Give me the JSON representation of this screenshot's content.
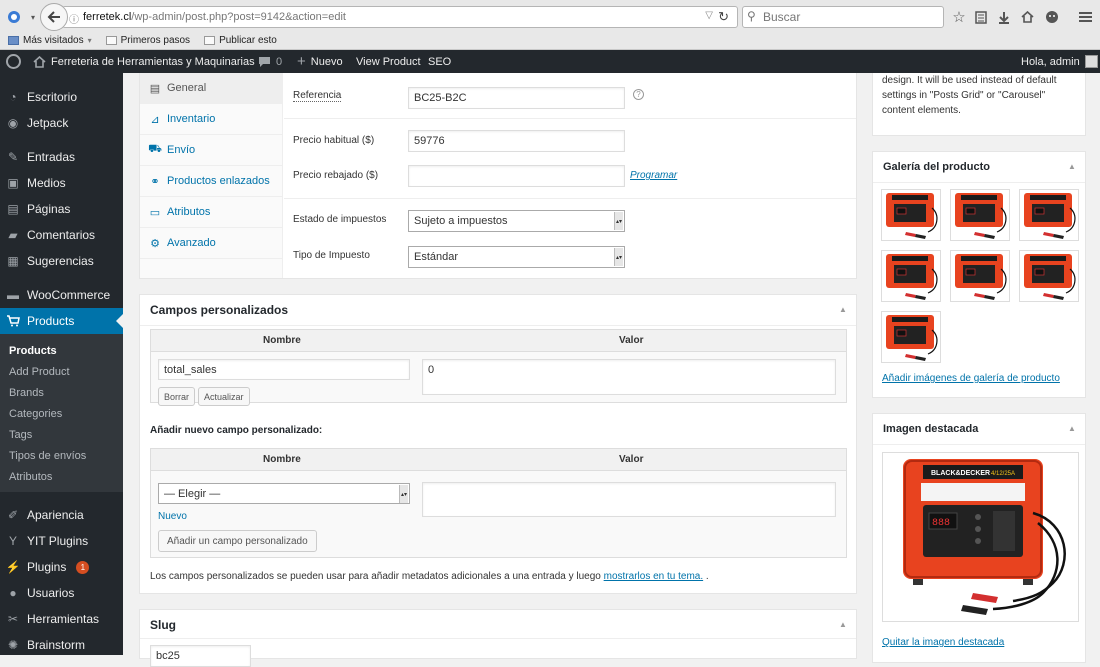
{
  "browser": {
    "url_host": "ferretek.cl",
    "url_path": "/wp-admin/post.php?post=9142&action=edit",
    "search_placeholder": "Buscar",
    "bookmarks": [
      "Más visitados",
      "Primeros pasos",
      "Publicar esto"
    ]
  },
  "admin_bar": {
    "site_name": "Ferreteria de Herramientas y Maquinarias",
    "comments_count": "0",
    "new_label": "Nuevo",
    "view_product": "View Product",
    "seo": "SEO",
    "greeting": "Hola, admin"
  },
  "sidebar": {
    "items": [
      "Escritorio",
      "Jetpack",
      "Entradas",
      "Medios",
      "Páginas",
      "Comentarios",
      "Sugerencias",
      "WooCommerce",
      "Products",
      "Apariencia",
      "YIT Plugins",
      "Plugins",
      "Usuarios",
      "Herramientas",
      "Brainstorm"
    ],
    "plugins_badge": "1",
    "submenu": [
      "Products",
      "Add Product",
      "Brands",
      "Categories",
      "Tags",
      "Tipos de envíos",
      "Atributos"
    ]
  },
  "product_data": {
    "tabs": [
      "General",
      "Inventario",
      "Envío",
      "Productos enlazados",
      "Atributos",
      "Avanzado"
    ],
    "referencia_label": "Referencia",
    "referencia_value": "BC25-B2C",
    "precio_habitual_label": "Precio habitual ($)",
    "precio_habitual_value": "59776",
    "precio_rebajado_label": "Precio rebajado ($)",
    "precio_rebajado_value": "",
    "programar_link": "Programar",
    "estado_impuestos_label": "Estado de impuestos",
    "estado_impuestos_value": "Sujeto a impuestos",
    "tipo_impuesto_label": "Tipo de Impuesto",
    "tipo_impuesto_value": "Estándar"
  },
  "custom_fields": {
    "title": "Campos personalizados",
    "col_nombre": "Nombre",
    "col_valor": "Valor",
    "row_name": "total_sales",
    "row_value": "0",
    "delete_btn": "Borrar",
    "update_btn": "Actualizar",
    "add_new_title": "Añadir nuevo campo personalizado:",
    "select_value": "— Elegir —",
    "nuevo_link": "Nuevo",
    "add_btn": "Añadir un campo personalizado",
    "footer_text": "Los campos personalizados se pueden usar para añadir metadatos adicionales a una entrada y luego",
    "footer_link": "mostrarlos en tu tema.",
    "footer_end": "."
  },
  "slug": {
    "title": "Slug",
    "value": "bc25"
  },
  "right_column": {
    "partial_lines": [
      "design. It will be used instead of default",
      "settings in \"Posts Grid\" or \"Carousel\"",
      "content elements."
    ],
    "gallery_title": "Galería del producto",
    "gallery_count": 7,
    "gallery_add_link": "Añadir imágenes de galería de producto",
    "featured_title": "Imagen destacada",
    "featured_remove_link": "Quitar la imagen destacada",
    "charger_brand": "BLACK&DECKER",
    "charger_model": "4/12/25A",
    "charger_display": "888"
  }
}
